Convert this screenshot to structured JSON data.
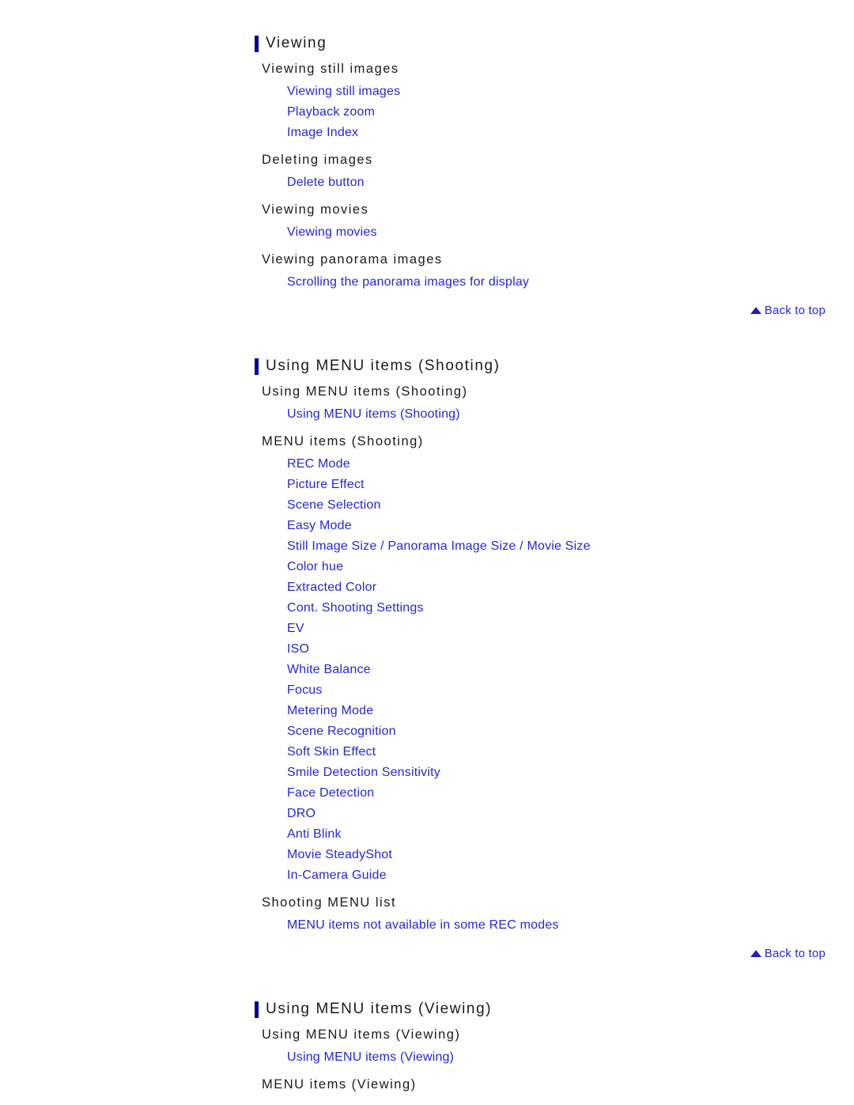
{
  "theme": {
    "background": "#ffffff",
    "heading_color": "#1a1a1a",
    "link_color": "#2727c9",
    "accent_bar_color": "#000099",
    "back_to_top_color": "#2020b5"
  },
  "back_to_top_label": "Back to top",
  "sections": [
    {
      "title": "Viewing",
      "groups": [
        {
          "heading": "Viewing still images",
          "links": [
            "Viewing still images",
            "Playback zoom",
            "Image Index"
          ]
        },
        {
          "heading": "Deleting images",
          "links": [
            "Delete button"
          ]
        },
        {
          "heading": "Viewing movies",
          "links": [
            "Viewing movies"
          ]
        },
        {
          "heading": "Viewing panorama images",
          "links": [
            "Scrolling the panorama images for display"
          ]
        }
      ],
      "has_back_to_top": true
    },
    {
      "title": "Using MENU items (Shooting)",
      "groups": [
        {
          "heading": "Using MENU items (Shooting)",
          "links": [
            "Using MENU items (Shooting)"
          ]
        },
        {
          "heading": "MENU items (Shooting)",
          "links": [
            "REC Mode",
            "Picture Effect",
            "Scene Selection",
            "Easy Mode",
            "Still Image Size / Panorama Image Size / Movie Size",
            "Color hue",
            "Extracted Color",
            "Cont. Shooting Settings",
            "EV",
            "ISO",
            "White Balance",
            "Focus",
            "Metering Mode",
            "Scene Recognition",
            "Soft Skin Effect",
            "Smile Detection Sensitivity",
            "Face Detection",
            "DRO",
            "Anti Blink",
            "Movie SteadyShot",
            "In-Camera Guide"
          ]
        },
        {
          "heading": "Shooting MENU list",
          "links": [
            "MENU items not available in some REC modes"
          ]
        }
      ],
      "has_back_to_top": true
    },
    {
      "title": "Using MENU items (Viewing)",
      "groups": [
        {
          "heading": "Using MENU items (Viewing)",
          "links": [
            "Using MENU items (Viewing)"
          ]
        },
        {
          "heading": "MENU items (Viewing)",
          "links": []
        }
      ],
      "has_back_to_top": false
    }
  ]
}
